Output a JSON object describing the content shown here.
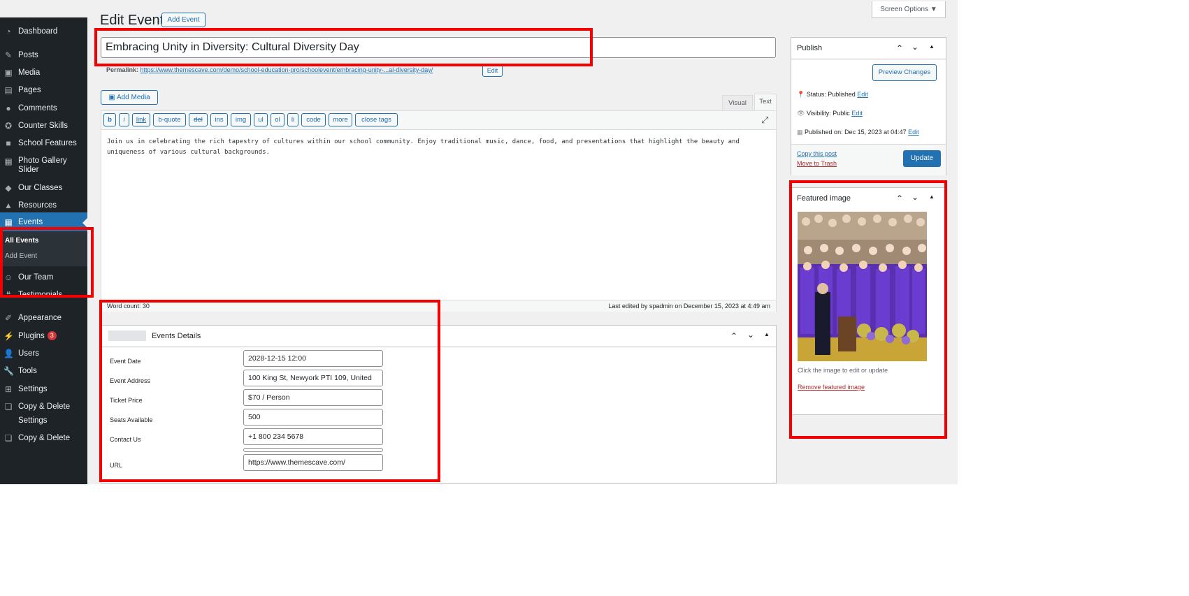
{
  "header": {
    "title": "Edit Event",
    "add_button": "Add Event",
    "screen_options": "Screen Options"
  },
  "sidebar": {
    "items": [
      {
        "label": "Dashboard",
        "icon": "dashboard-icon"
      },
      {
        "label": "Posts",
        "icon": "pin-icon"
      },
      {
        "label": "Media",
        "icon": "media-icon"
      },
      {
        "label": "Pages",
        "icon": "pages-icon"
      },
      {
        "label": "Comments",
        "icon": "comments-icon"
      },
      {
        "label": "Counter Skills",
        "icon": "counter-icon"
      },
      {
        "label": "School Features",
        "icon": "features-icon"
      },
      {
        "label": "Photo Gallery Slider",
        "icon": "gallery-icon"
      },
      {
        "label": "Our Classes",
        "icon": "classes-icon"
      },
      {
        "label": "Resources",
        "icon": "resources-icon"
      },
      {
        "label": "Events",
        "icon": "events-icon"
      },
      {
        "label": "Our Team",
        "icon": "team-icon"
      },
      {
        "label": "Testimonials",
        "icon": "quote-icon"
      },
      {
        "label": "Appearance",
        "icon": "appearance-icon"
      },
      {
        "label": "Plugins",
        "icon": "plugins-icon",
        "badge": "3"
      },
      {
        "label": "Users",
        "icon": "users-icon"
      },
      {
        "label": "Tools",
        "icon": "tools-icon"
      },
      {
        "label": "Settings",
        "icon": "settings-icon"
      },
      {
        "label": "Copy & Delete",
        "icon": "copy-icon"
      },
      {
        "label": "Settings",
        "icon": "settings-icon"
      },
      {
        "label": "Copy & Delete",
        "icon": "copy-icon"
      }
    ],
    "events_submenu": [
      "All Events",
      "Add Event"
    ]
  },
  "post": {
    "title": "Embracing Unity in Diversity: Cultural Diversity Day",
    "permalink_label": "Permalink:",
    "permalink_url": "https://www.themescave.com/demo/school-education-pro/schoolevent/embracing-unity-...al-diversity-day/",
    "permalink_edit": "Edit"
  },
  "editor": {
    "add_media": "Add Media",
    "tab_visual": "Visual",
    "tab_text": "Text",
    "quicktags": [
      "b",
      "i",
      "link",
      "b-quote",
      "del",
      "ins",
      "img",
      "ul",
      "ol",
      "li",
      "code",
      "more",
      "close tags"
    ],
    "content": "Join us in celebrating the rich tapestry of cultures within our school community. Enjoy traditional music, dance, food, and presentations that highlight the beauty and uniqueness of various cultural backgrounds.",
    "word_count": "Word count: 30",
    "last_edited": "Last edited by spadmin on December 15, 2023 at 4:49 am"
  },
  "events_details": {
    "title": "Events Details",
    "fields": [
      {
        "label": "Event Date",
        "value": "2028-12-15 12:00"
      },
      {
        "label": "Event Address",
        "value": "100 King St, Newyork PTI 109, United"
      },
      {
        "label": "Ticket Price",
        "value": "$70  / Person"
      },
      {
        "label": "Seats Available",
        "value": "500"
      },
      {
        "label": "Contact Us",
        "value": "+1 800 234 5678"
      },
      {
        "label": "URL",
        "value": "https://www.themescave.com/"
      }
    ]
  },
  "publish": {
    "title": "Publish",
    "preview": "Preview Changes",
    "status": "Status: Published",
    "visibility": "Visibility: Public",
    "published_on": "Published on: Dec 15, 2023 at 04:47",
    "edit": "Edit",
    "copy": "Copy this post",
    "trash": "Move to Trash",
    "update": "Update"
  },
  "featured_image": {
    "title": "Featured image",
    "hint": "Click the image to edit or update",
    "remove": "Remove featured image"
  },
  "colors": {
    "accent": "#2271b1",
    "sidebar": "#1d2327",
    "highlight_box": "#f50000"
  }
}
